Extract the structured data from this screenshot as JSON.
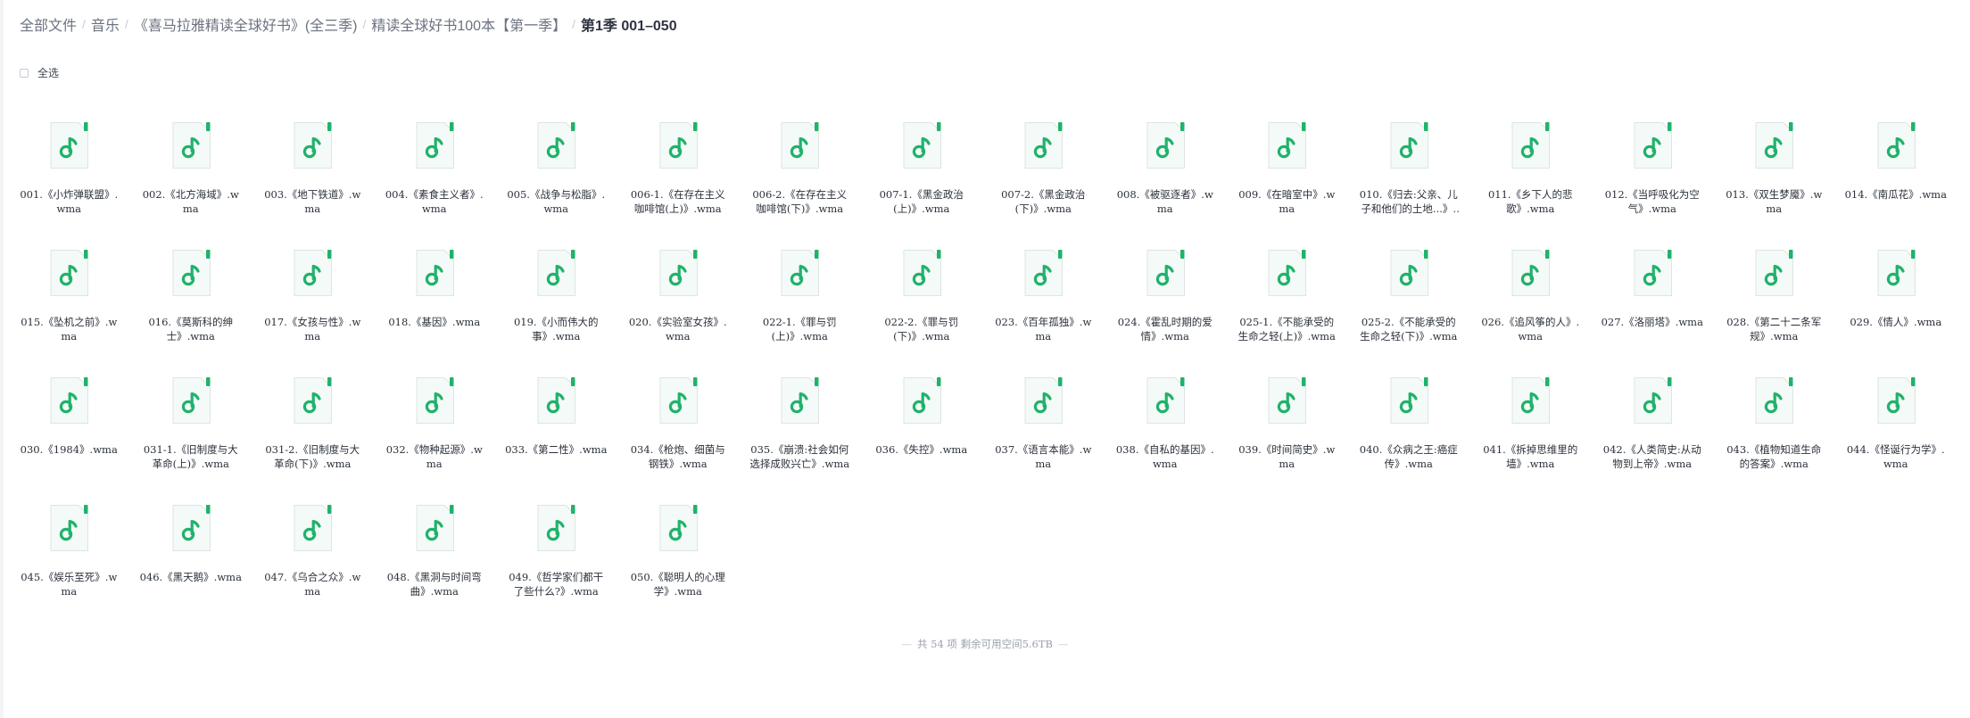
{
  "breadcrumb": [
    {
      "label": "全部文件"
    },
    {
      "label": "音乐"
    },
    {
      "label": "《喜马拉雅精读全球好书》(全三季)"
    },
    {
      "label": "精读全球好书100本【第一季】"
    },
    {
      "label": "第1季 001–050"
    }
  ],
  "select_all_label": "全选",
  "icon": {
    "name": "music-file-icon",
    "accent": "#20b26c",
    "paper": "#f4faf7"
  },
  "files": [
    {
      "name": "001.《小炸弹联盟》.wma"
    },
    {
      "name": "002.《北方海域》.wma"
    },
    {
      "name": "003.《地下铁道》.wma"
    },
    {
      "name": "004.《素食主义者》.wma"
    },
    {
      "name": "005.《战争与松脂》.wma"
    },
    {
      "name": "006-1.《在存在主义咖啡馆(上)》.wma"
    },
    {
      "name": "006-2.《在存在主义咖啡馆(下)》.wma"
    },
    {
      "name": "007-1.《黑金政治(上)》.wma"
    },
    {
      "name": "007-2.《黑金政治(下)》.wma"
    },
    {
      "name": "008.《被驱逐者》.wma"
    },
    {
      "name": "009.《在暗室中》.wma"
    },
    {
      "name": "010.《归去:父亲、儿子和他们的土地...》.wma"
    },
    {
      "name": "011.《乡下人的悲歌》.wma"
    },
    {
      "name": "012.《当呼吸化为空气》.wma"
    },
    {
      "name": "013.《双生梦魇》.wma"
    },
    {
      "name": "014.《南瓜花》.wma"
    },
    {
      "name": "015.《坠机之前》.wma"
    },
    {
      "name": "016.《莫斯科的绅士》.wma"
    },
    {
      "name": "017.《女孩与性》.wma"
    },
    {
      "name": "018.《基因》.wma"
    },
    {
      "name": "019.《小而伟大的事》.wma"
    },
    {
      "name": "020.《实验室女孩》.wma"
    },
    {
      "name": "022-1.《罪与罚(上)》.wma"
    },
    {
      "name": "022-2.《罪与罚(下)》.wma"
    },
    {
      "name": "023.《百年孤独》.wma"
    },
    {
      "name": "024.《霍乱时期的爱情》.wma"
    },
    {
      "name": "025-1.《不能承受的生命之轻(上)》.wma"
    },
    {
      "name": "025-2.《不能承受的生命之轻(下)》.wma"
    },
    {
      "name": "026.《追风筝的人》.wma"
    },
    {
      "name": "027.《洛丽塔》.wma"
    },
    {
      "name": "028.《第二十二条军规》.wma"
    },
    {
      "name": "029.《情人》.wma"
    },
    {
      "name": "030.《1984》.wma"
    },
    {
      "name": "031-1.《旧制度与大革命(上)》.wma"
    },
    {
      "name": "031-2.《旧制度与大革命(下)》.wma"
    },
    {
      "name": "032.《物种起源》.wma"
    },
    {
      "name": "033.《第二性》.wma"
    },
    {
      "name": "034.《枪炮、细菌与钢铁》.wma"
    },
    {
      "name": "035.《崩溃:社会如何选择成败兴亡》.wma"
    },
    {
      "name": "036.《失控》.wma"
    },
    {
      "name": "037.《语言本能》.wma"
    },
    {
      "name": "038.《自私的基因》.wma"
    },
    {
      "name": "039.《时间简史》.wma"
    },
    {
      "name": "040.《众病之王:癌症传》.wma"
    },
    {
      "name": "041.《拆掉思维里的墙》.wma"
    },
    {
      "name": "042.《人类简史:从动物到上帝》.wma"
    },
    {
      "name": "043.《植物知道生命的答案》.wma"
    },
    {
      "name": "044.《怪诞行为学》.wma"
    },
    {
      "name": "045.《娱乐至死》.wma"
    },
    {
      "name": "046.《黑天鹅》.wma"
    },
    {
      "name": "047.《乌合之众》.wma"
    },
    {
      "name": "048.《黑洞与时间弯曲》.wma"
    },
    {
      "name": "049.《哲学家们都干了些什么?》.wma"
    },
    {
      "name": "050.《聪明人的心理学》.wma"
    }
  ],
  "footer": {
    "text": "共 54 项 剩余可用空间5.6TB"
  }
}
